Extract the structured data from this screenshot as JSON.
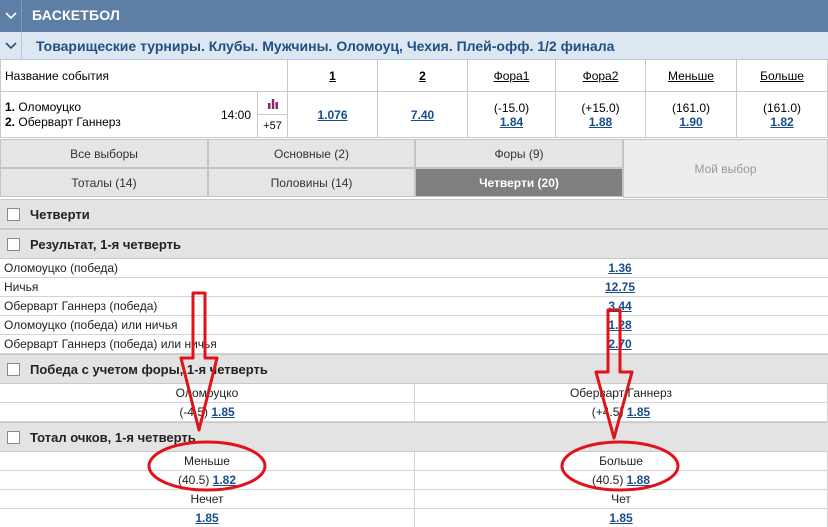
{
  "sport_header": {
    "title": "БАСКЕТБОЛ"
  },
  "league": {
    "title": "Товарищеские турниры. Клубы. Мужчины. Оломоуц, Чехия. Плей-офф. 1/2 финала"
  },
  "columns": {
    "event_name": "Название события",
    "c1": "1",
    "c2": "2",
    "fora1": "Фора1",
    "fora2": "Фора2",
    "under": "Меньше",
    "over": "Больше"
  },
  "event": {
    "team1_num": "1.",
    "team1": "Оломоуцко",
    "team2_num": "2.",
    "team2": "Обервapт Ганнерз",
    "time": "14:00",
    "more": "+57",
    "odd1": "1.076",
    "odd2": "7.40",
    "fora1_line": "(-15.0)",
    "fora1_odd": "1.84",
    "fora2_line": "(+15.0)",
    "fora2_odd": "1.88",
    "under_line": "(161.0)",
    "under_odd": "1.90",
    "over_line": "(161.0)",
    "over_odd": "1.82"
  },
  "tabs": {
    "all": "Все выборы",
    "main": "Основные (2)",
    "fora": "Форы (9)",
    "my": "Мой выбор",
    "totals": "Тоталы (14)",
    "halves": "Половины (14)",
    "quarters": "Четверти (20)"
  },
  "sections": {
    "quarters": "Четверти",
    "result_q1": "Результат, 1-я четверть",
    "handicap_q1": "Победа с учетом форы, 1-я четверть",
    "total_q1": "Тотал очков, 1-я четверть"
  },
  "result_rows": [
    {
      "name": "Оломоуцко (победа)",
      "odd": "1.36"
    },
    {
      "name": "Ничья",
      "odd": "12.75"
    },
    {
      "name": "Оберварт Ганнерз (победа)",
      "odd": "3.44"
    },
    {
      "name": "Оломоуцко (победа) или ничья",
      "odd": "1.28"
    },
    {
      "name": "Оберварт Ганнерз (победа) или ничья",
      "odd": "2.70"
    }
  ],
  "handicap": {
    "left_head": "Оломоуцко",
    "right_head": "Оберварт Ганнерз",
    "left_line": "(-4.5)",
    "left_odd": "1.85",
    "right_line": "(+4.5)",
    "right_odd": "1.85"
  },
  "total": {
    "left_head": "Меньше",
    "right_head": "Больше",
    "left_line": "(40.5)",
    "left_odd": "1.82",
    "right_line": "(40.5)",
    "right_odd": "1.88"
  },
  "parity": {
    "left_head": "Нечет",
    "right_head": "Чет",
    "left_odd": "1.85",
    "right_odd": "1.85"
  },
  "colors": {
    "header_bg": "#5d7fa6",
    "league_bg": "#dde7f1",
    "link": "#1a4d8c",
    "annotation": "#e0121a"
  }
}
